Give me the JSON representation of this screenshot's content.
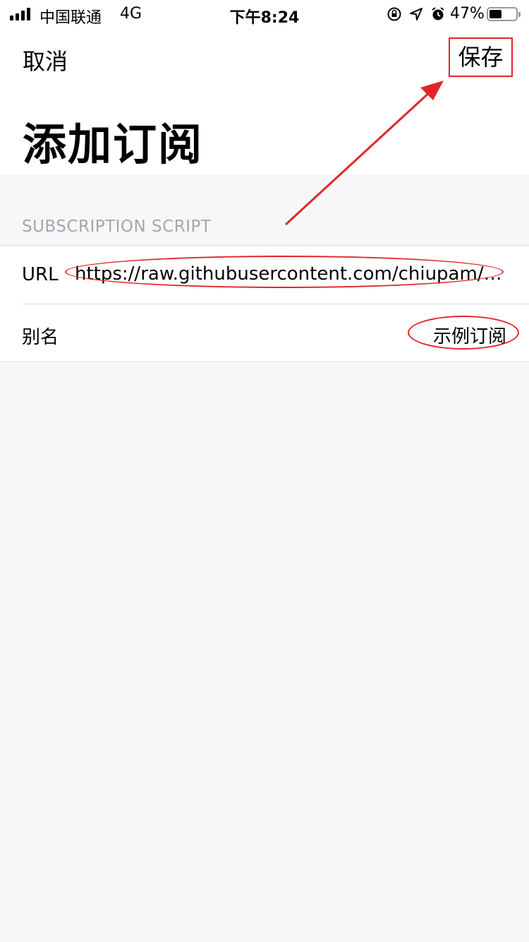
{
  "status_bar": {
    "carrier": "中国联通",
    "network": "4G",
    "time": "下午8:24",
    "battery_percent": "47%",
    "battery_level": 0.47,
    "icons": [
      "orientation-lock-icon",
      "location-icon",
      "alarm-icon"
    ]
  },
  "nav": {
    "cancel_label": "取消",
    "save_label": "保存"
  },
  "page": {
    "title": "添加订阅"
  },
  "section": {
    "header": "SUBSCRIPTION SCRIPT",
    "rows": [
      {
        "label": "URL",
        "value": "https://raw.githubusercontent.com/chiupam/P..."
      },
      {
        "label": "别名",
        "value": "示例订阅"
      }
    ]
  },
  "annotation": {
    "color": "#e0262a"
  }
}
